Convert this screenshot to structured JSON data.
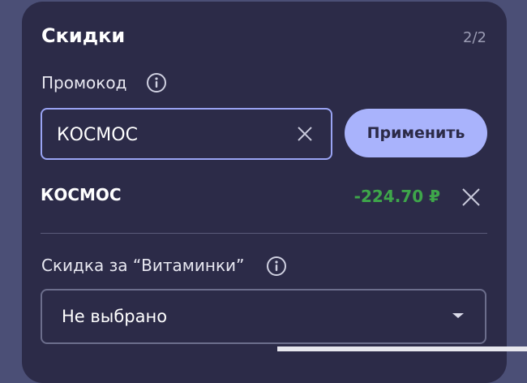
{
  "card": {
    "title": "Скидки",
    "step": "2/2"
  },
  "promo": {
    "label": "Промокод",
    "input_value": "КОСМОС",
    "apply_label": "Применить"
  },
  "applied": {
    "code": "КОСМОС",
    "amount": "-224.70 ₽"
  },
  "vitamins": {
    "label": "Скидка за “Витаминки”",
    "selected": "Не выбрано"
  },
  "colors": {
    "background": "#4b4f76",
    "card": "#2c2b48",
    "accent": "#a9b3fc",
    "focus_border": "#9aa4f4",
    "discount": "#3ea64a"
  },
  "icons": {
    "info": "info-icon",
    "clear": "close-icon",
    "remove": "close-icon",
    "dropdown": "chevron-down-icon"
  }
}
